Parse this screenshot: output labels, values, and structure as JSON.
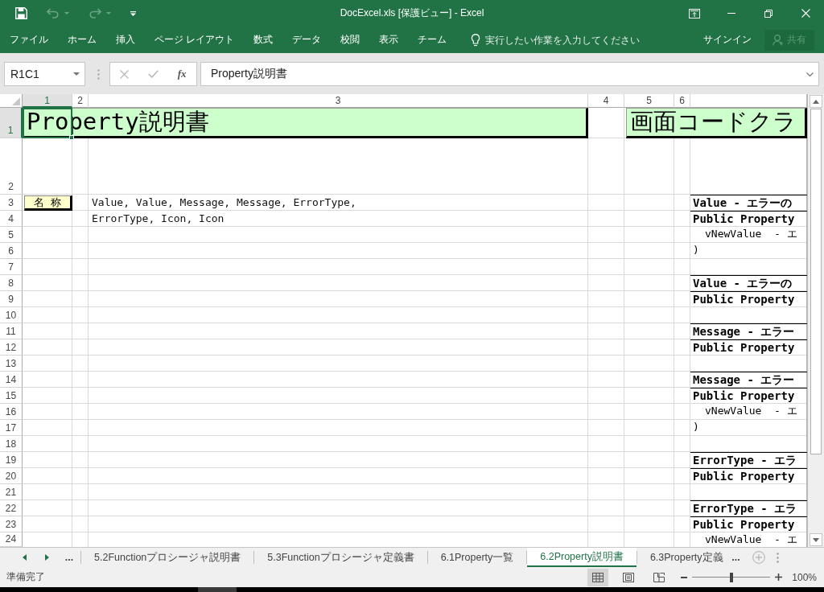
{
  "window": {
    "title": "DocExcel.xls [保護ビュー] - Excel"
  },
  "quick_access": [
    {
      "kind": "save",
      "disabled": false
    },
    {
      "kind": "undo",
      "disabled": true
    },
    {
      "kind": "redo",
      "disabled": true
    },
    {
      "kind": "customize",
      "disabled": false
    }
  ],
  "ribbon": {
    "tabs": [
      {
        "label": "ファイル",
        "selected": false
      },
      {
        "label": "ホーム",
        "selected": false
      },
      {
        "label": "挿入",
        "selected": false
      },
      {
        "label": "ページ レイアウト",
        "selected": false
      },
      {
        "label": "数式",
        "selected": false
      },
      {
        "label": "データ",
        "selected": false
      },
      {
        "label": "校閲",
        "selected": false
      },
      {
        "label": "表示",
        "selected": false
      },
      {
        "label": "チーム",
        "selected": false
      }
    ],
    "tell_me": {
      "placeholder": "実行したい作業を入力してください"
    },
    "sign_in": "サインイン",
    "share": {
      "label": "共有",
      "disabled": true
    }
  },
  "formula_bar": {
    "name_box": "R1C1",
    "buttons": [
      {
        "kind": "cancel",
        "disabled": true
      },
      {
        "kind": "enter",
        "disabled": true
      }
    ],
    "insert_function": "fx",
    "value": "Property説明書"
  },
  "sheet": {
    "columns": [
      {
        "label": "1",
        "selected": true
      },
      {
        "label": "2",
        "selected": false
      },
      {
        "label": "3",
        "selected": false
      },
      {
        "label": "4",
        "selected": false
      },
      {
        "label": "5",
        "selected": false
      },
      {
        "label": "6",
        "selected": false
      }
    ],
    "rows": [
      {
        "label": "1",
        "selected": true,
        "banners": [
          "Property説明書",
          "画面コードクラ"
        ]
      },
      {
        "label": "2",
        "selected": false
      },
      {
        "label": "3",
        "selected": false,
        "column_1": "名 称",
        "column_3": "Value, Value, Message, Message, ErrorType,",
        "column_7": {
          "kind": "heading",
          "text": "Value - エラーの"
        }
      },
      {
        "label": "4",
        "selected": false,
        "column_3": "ErrorType, Icon, Icon",
        "column_7": {
          "kind": "declaration",
          "text": "Public Property"
        }
      },
      {
        "label": "5",
        "selected": false,
        "column_7": {
          "kind": "parameter",
          "text": "vNewValue  - エ"
        }
      },
      {
        "label": "6",
        "selected": false,
        "column_7": {
          "kind": "end",
          "text": ")"
        }
      },
      {
        "label": "7",
        "selected": false
      },
      {
        "label": "8",
        "selected": false,
        "column_7": {
          "kind": "heading",
          "text": "Value - エラーの"
        }
      },
      {
        "label": "9",
        "selected": false,
        "column_7": {
          "kind": "declaration",
          "text": "Public Property"
        }
      },
      {
        "label": "10",
        "selected": false
      },
      {
        "label": "11",
        "selected": false,
        "column_7": {
          "kind": "heading",
          "text": "Message - エラー"
        }
      },
      {
        "label": "12",
        "selected": false,
        "column_7": {
          "kind": "declaration",
          "text": "Public Property"
        }
      },
      {
        "label": "13",
        "selected": false
      },
      {
        "label": "14",
        "selected": false,
        "column_7": {
          "kind": "heading",
          "text": "Message - エラー"
        }
      },
      {
        "label": "15",
        "selected": false,
        "column_7": {
          "kind": "declaration",
          "text": "Public Property"
        }
      },
      {
        "label": "16",
        "selected": false,
        "column_7": {
          "kind": "parameter",
          "text": "vNewValue  - エ"
        }
      },
      {
        "label": "17",
        "selected": false,
        "column_7": {
          "kind": "end",
          "text": ")"
        }
      },
      {
        "label": "18",
        "selected": false
      },
      {
        "label": "19",
        "selected": false,
        "column_7": {
          "kind": "heading",
          "text": "ErrorType - エラ"
        }
      },
      {
        "label": "20",
        "selected": false,
        "column_7": {
          "kind": "declaration",
          "text": "Public Property"
        }
      },
      {
        "label": "21",
        "selected": false
      },
      {
        "label": "22",
        "selected": false,
        "column_7": {
          "kind": "heading",
          "text": "ErrorType - エラ"
        }
      },
      {
        "label": "23",
        "selected": false,
        "column_7": {
          "kind": "declaration",
          "text": "Public Property"
        }
      },
      {
        "label": "24",
        "selected": false,
        "column_7": {
          "kind": "parameter",
          "text": "vNewValue  - エ"
        }
      }
    ]
  },
  "sheet_tabs": {
    "more_before": "...",
    "tabs": [
      {
        "label": "5.2Functionプロシージャ説明書",
        "selected": false
      },
      {
        "label": "5.3Functionプロシージャ定義書",
        "selected": false
      },
      {
        "label": "6.1Property一覧",
        "selected": false
      },
      {
        "label": "6.2Property説明書",
        "selected": true
      },
      {
        "label": "6.3Property定義",
        "selected": false
      }
    ],
    "more_after": "..."
  },
  "status_bar": {
    "text": "準備完了",
    "views": [
      {
        "kind": "normal",
        "selected": true
      },
      {
        "kind": "page_layout",
        "selected": false
      },
      {
        "kind": "page_break",
        "selected": false
      }
    ],
    "zoom": {
      "level": 0.5,
      "label": "100%"
    }
  }
}
